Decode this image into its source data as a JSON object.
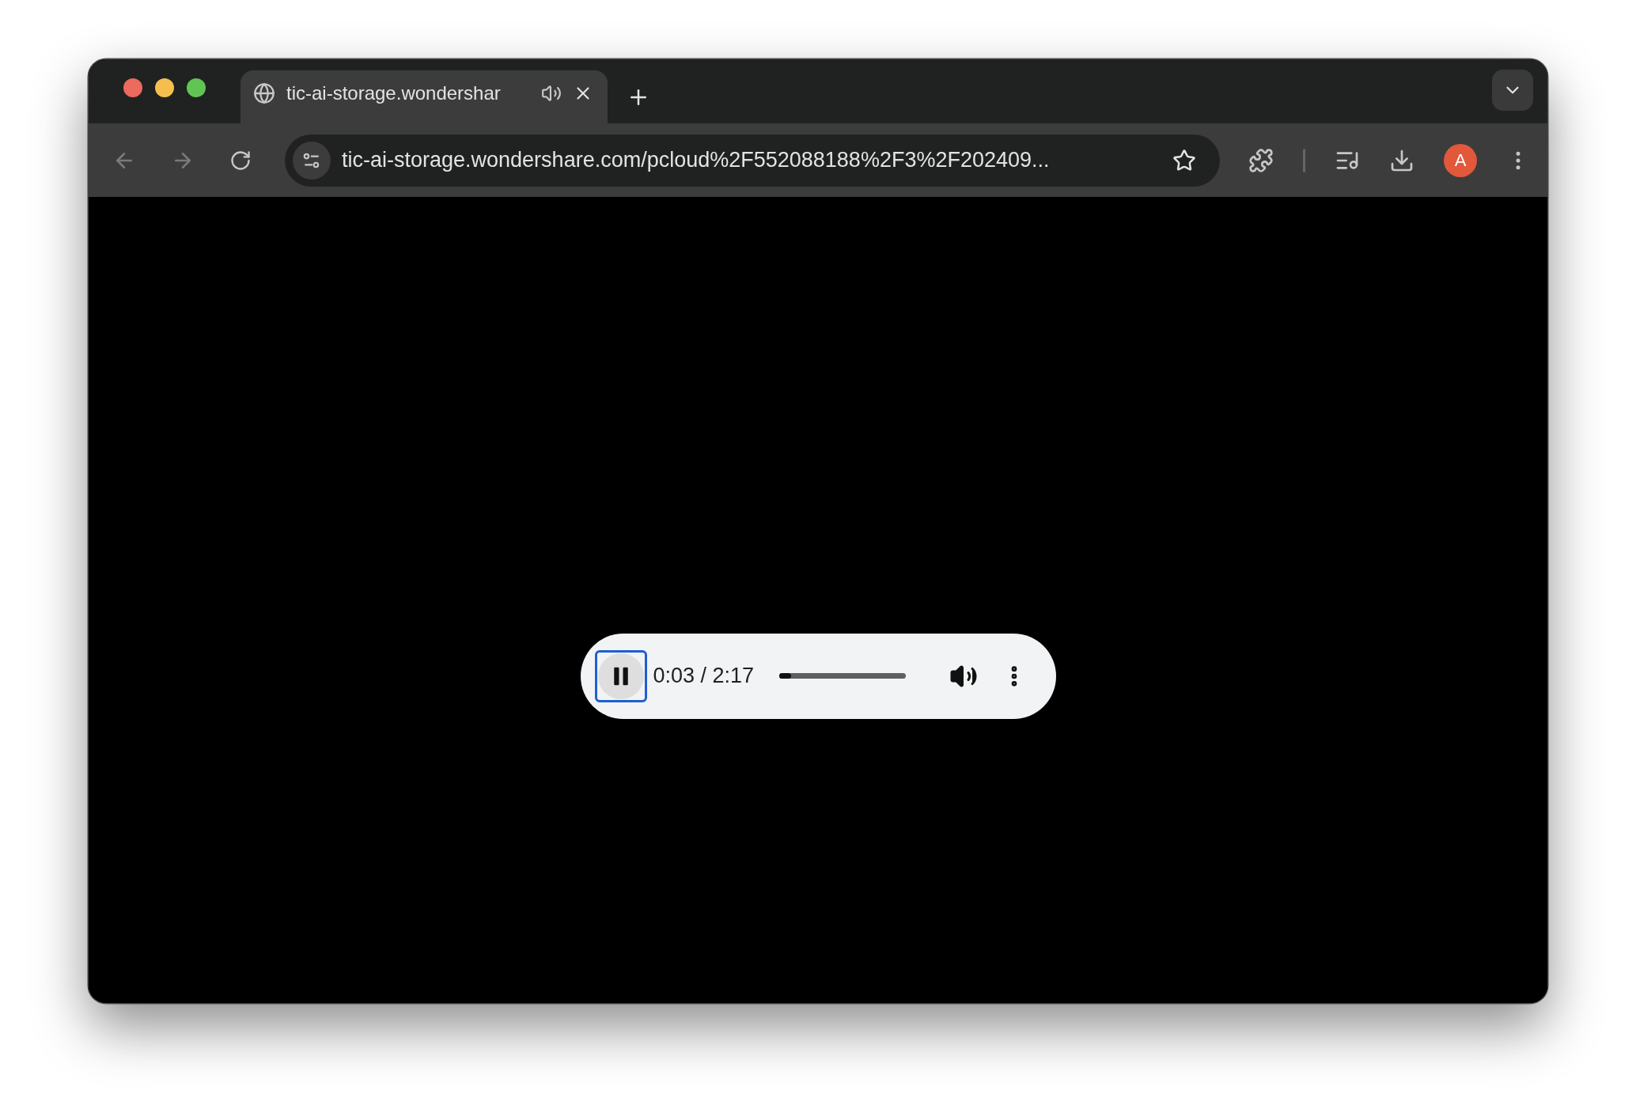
{
  "tab": {
    "title": "tic-ai-storage.wondershar",
    "audible": true,
    "selected": true
  },
  "toolbar": {
    "url": "tic-ai-storage.wondershare.com/pcloud%2F552088188%2F3%2F202409...",
    "bookmarked": false,
    "avatar": "A"
  },
  "player": {
    "playing": true,
    "focused": true,
    "time": "0:03 / 2:17",
    "level": 0.09
  }
}
